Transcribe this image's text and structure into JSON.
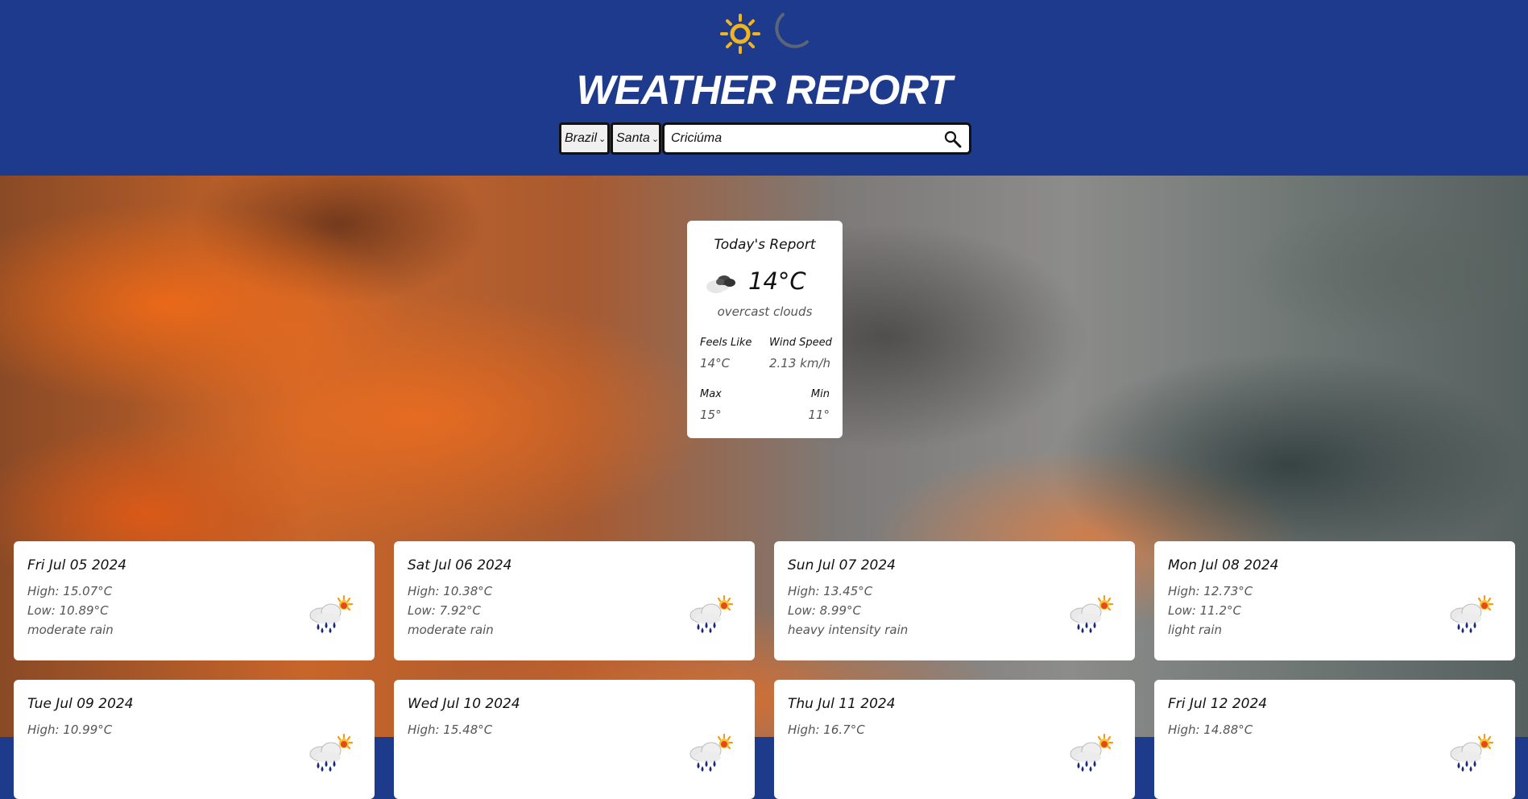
{
  "header": {
    "title": "WEATHER REPORT",
    "theme_icons": [
      "sun-icon",
      "moon-icon"
    ],
    "colors": {
      "header_bg": "#1e3a8c",
      "sun": "#f0b420",
      "moon": "#5b6478"
    }
  },
  "search": {
    "country_selected": "Brazil",
    "state_selected": "Santa",
    "city_value": "Criciúma",
    "icon": "search-icon"
  },
  "today": {
    "title": "Today's Report",
    "icon": "cloud-icon",
    "temperature": "14°C",
    "description": "overcast clouds",
    "feels_like_label": "Feels Like",
    "feels_like_value": "14°C",
    "wind_label": "Wind Speed",
    "wind_value": "2.13 km/h",
    "max_label": "Max",
    "max_value": "15°",
    "min_label": "Min",
    "min_value": "11°"
  },
  "forecast": [
    {
      "date": "Fri Jul 05 2024",
      "high": "High: 15.07°C",
      "low": "Low: 10.89°C",
      "desc": "moderate rain",
      "icon": "rain-sun-icon"
    },
    {
      "date": "Sat Jul 06 2024",
      "high": "High: 10.38°C",
      "low": "Low: 7.92°C",
      "desc": "moderate rain",
      "icon": "rain-sun-icon"
    },
    {
      "date": "Sun Jul 07 2024",
      "high": "High: 13.45°C",
      "low": "Low: 8.99°C",
      "desc": "heavy intensity rain",
      "icon": "rain-sun-icon"
    },
    {
      "date": "Mon Jul 08 2024",
      "high": "High: 12.73°C",
      "low": "Low: 11.2°C",
      "desc": "light rain",
      "icon": "rain-sun-icon"
    },
    {
      "date": "Tue Jul 09 2024",
      "high": "High: 10.99°C",
      "low": "",
      "desc": "",
      "icon": "rain-sun-icon"
    },
    {
      "date": "Wed Jul 10 2024",
      "high": "High: 15.48°C",
      "low": "",
      "desc": "",
      "icon": "rain-sun-icon"
    },
    {
      "date": "Thu Jul 11 2024",
      "high": "High: 16.7°C",
      "low": "",
      "desc": "",
      "icon": "rain-sun-icon"
    },
    {
      "date": "Fri Jul 12 2024",
      "high": "High: 14.88°C",
      "low": "",
      "desc": "",
      "icon": "rain-sun-icon"
    }
  ]
}
